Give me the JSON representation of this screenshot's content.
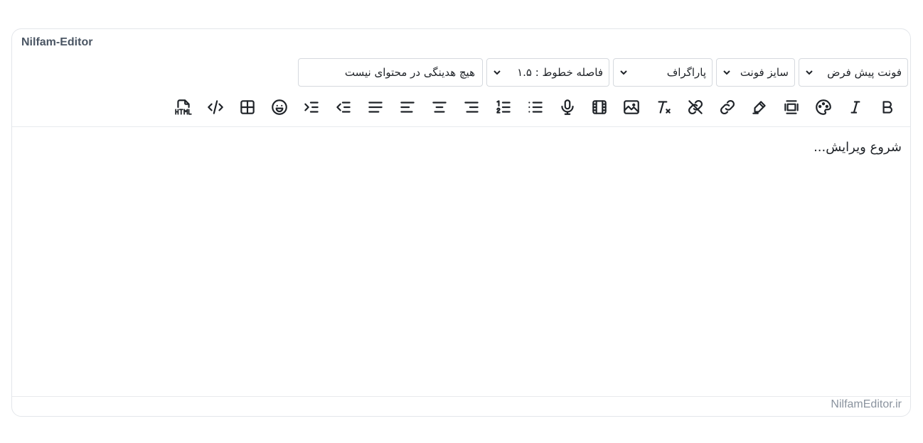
{
  "editor": {
    "title": "Nilfam-Editor",
    "content_placeholder": "شروع ویرایش...",
    "footer": "NilfamEditor.ir"
  },
  "selects": [
    {
      "label": "فونت پیش فرض"
    },
    {
      "label": "سایز فونت"
    },
    {
      "label": "پاراگراف"
    },
    {
      "label": "فاصله خطوط : ۱.۵"
    },
    {
      "label": "هیچ هدینگی در محتوای نیست"
    }
  ],
  "toolbar_icons": [
    "bold-icon",
    "italic-icon",
    "palette-icon",
    "frame-icon",
    "highlighter-icon",
    "link-icon",
    "unlink-icon",
    "clear-format-icon",
    "image-icon",
    "video-icon",
    "microphone-icon",
    "bullet-list-icon",
    "numbered-list-icon",
    "align-right-icon",
    "align-center-icon",
    "align-left-icon",
    "align-justify-icon",
    "outdent-icon",
    "indent-icon",
    "emoji-icon",
    "table-icon",
    "code-icon",
    "html-icon"
  ]
}
